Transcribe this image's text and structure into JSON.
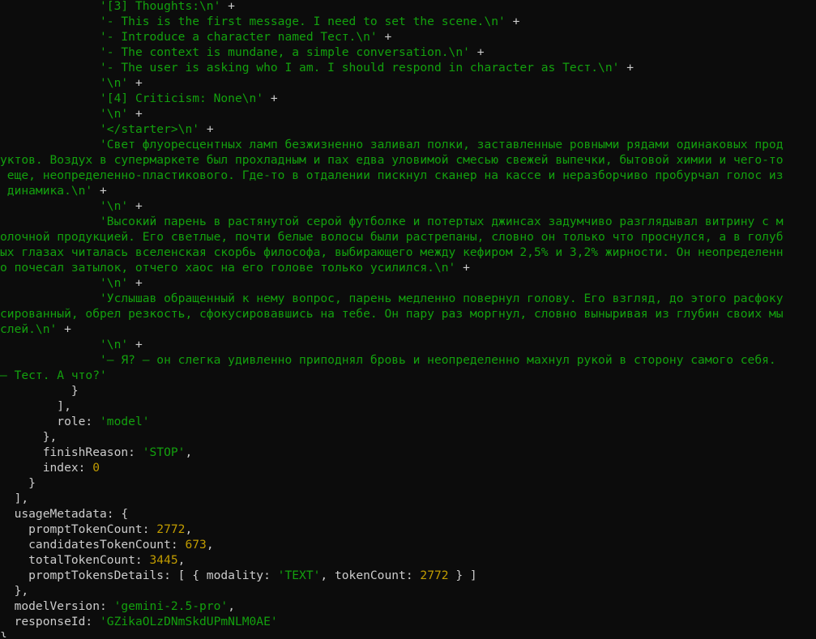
{
  "terminal": {
    "colors": {
      "background": "#0c0c0c",
      "default": "#cccccc",
      "string": "#13a10e",
      "number": "#c19c00"
    },
    "lines": [
      [
        {
          "t": "              ",
          "c": "p"
        },
        {
          "t": "'[3] Thoughts:\\n'",
          "c": "s"
        },
        {
          "t": " +",
          "c": "p"
        }
      ],
      [
        {
          "t": "              ",
          "c": "p"
        },
        {
          "t": "'- This is the first message. I need to set the scene.\\n'",
          "c": "s"
        },
        {
          "t": " +",
          "c": "p"
        }
      ],
      [
        {
          "t": "              ",
          "c": "p"
        },
        {
          "t": "'- Introduce a character named Тест.\\n'",
          "c": "s"
        },
        {
          "t": " +",
          "c": "p"
        }
      ],
      [
        {
          "t": "              ",
          "c": "p"
        },
        {
          "t": "'- The context is mundane, a simple conversation.\\n'",
          "c": "s"
        },
        {
          "t": " +",
          "c": "p"
        }
      ],
      [
        {
          "t": "              ",
          "c": "p"
        },
        {
          "t": "'- The user is asking who I am. I should respond in character as Тест.\\n'",
          "c": "s"
        },
        {
          "t": " +",
          "c": "p"
        }
      ],
      [
        {
          "t": "              ",
          "c": "p"
        },
        {
          "t": "'\\n'",
          "c": "s"
        },
        {
          "t": " +",
          "c": "p"
        }
      ],
      [
        {
          "t": "              ",
          "c": "p"
        },
        {
          "t": "'[4] Criticism: None\\n'",
          "c": "s"
        },
        {
          "t": " +",
          "c": "p"
        }
      ],
      [
        {
          "t": "              ",
          "c": "p"
        },
        {
          "t": "'\\n'",
          "c": "s"
        },
        {
          "t": " +",
          "c": "p"
        }
      ],
      [
        {
          "t": "              ",
          "c": "p"
        },
        {
          "t": "'</starter>\\n'",
          "c": "s"
        },
        {
          "t": " +",
          "c": "p"
        }
      ],
      [
        {
          "t": "              ",
          "c": "p"
        },
        {
          "t": "'Свет флуоресцентных ламп безжизненно заливал полки, заставленные ровными рядами одинаковых прод",
          "c": "s"
        }
      ],
      [
        {
          "t": "уктов. Воздух в супермаркете был прохладным и пах едва уловимой смесью свежей выпечки, бытовой химии и чего-то",
          "c": "s"
        }
      ],
      [
        {
          "t": " еще, неопределенно-пластикового. Где-то в отдалении пискнул сканер на кассе и неразборчиво пробурчал голос из",
          "c": "s"
        }
      ],
      [
        {
          "t": " динамика.\\n'",
          "c": "s"
        },
        {
          "t": " +",
          "c": "p"
        }
      ],
      [
        {
          "t": "              ",
          "c": "p"
        },
        {
          "t": "'\\n'",
          "c": "s"
        },
        {
          "t": " +",
          "c": "p"
        }
      ],
      [
        {
          "t": "              ",
          "c": "p"
        },
        {
          "t": "'Высокий парень в растянутой серой футболке и потертых джинсах задумчиво разглядывал витрину с м",
          "c": "s"
        }
      ],
      [
        {
          "t": "олочной продукцией. Его светлые, почти белые волосы были растрепаны, словно он только что проснулся, а в голуб",
          "c": "s"
        }
      ],
      [
        {
          "t": "ых глазах читалась вселенская скорбь философа, выбирающего между кефиром 2,5% и 3,2% жирности. Он неопределенн",
          "c": "s"
        }
      ],
      [
        {
          "t": "о почесал затылок, отчего хаос на его голове только усилился.\\n'",
          "c": "s"
        },
        {
          "t": " +",
          "c": "p"
        }
      ],
      [
        {
          "t": "              ",
          "c": "p"
        },
        {
          "t": "'\\n'",
          "c": "s"
        },
        {
          "t": " +",
          "c": "p"
        }
      ],
      [
        {
          "t": "              ",
          "c": "p"
        },
        {
          "t": "'Услышав обращенный к нему вопрос, парень медленно повернул голову. Его взгляд, до этого расфоку",
          "c": "s"
        }
      ],
      [
        {
          "t": "сированный, обрел резкость, сфокусировавшись на тебе. Он пару раз моргнул, словно выныривая из глубин своих мы",
          "c": "s"
        }
      ],
      [
        {
          "t": "слей.\\n'",
          "c": "s"
        },
        {
          "t": " +",
          "c": "p"
        }
      ],
      [
        {
          "t": "              ",
          "c": "p"
        },
        {
          "t": "'\\n'",
          "c": "s"
        },
        {
          "t": " +",
          "c": "p"
        }
      ],
      [
        {
          "t": "              ",
          "c": "p"
        },
        {
          "t": "'— Я? — он слегка удивленно приподнял бровь и неопределенно махнул рукой в сторону самого себя.",
          "c": "s"
        }
      ],
      [
        {
          "t": "— Тест. А что?'",
          "c": "s"
        }
      ],
      [
        {
          "t": "          }",
          "c": "p"
        }
      ],
      [
        {
          "t": "        ],",
          "c": "p"
        }
      ],
      [
        {
          "t": "        role: ",
          "c": "p"
        },
        {
          "t": "'model'",
          "c": "s"
        }
      ],
      [
        {
          "t": "      },",
          "c": "p"
        }
      ],
      [
        {
          "t": "      finishReason: ",
          "c": "p"
        },
        {
          "t": "'STOP'",
          "c": "s"
        },
        {
          "t": ",",
          "c": "p"
        }
      ],
      [
        {
          "t": "      index: ",
          "c": "p"
        },
        {
          "t": "0",
          "c": "n"
        }
      ],
      [
        {
          "t": "    }",
          "c": "p"
        }
      ],
      [
        {
          "t": "  ],",
          "c": "p"
        }
      ],
      [
        {
          "t": "  usageMetadata: {",
          "c": "p"
        }
      ],
      [
        {
          "t": "    promptTokenCount: ",
          "c": "p"
        },
        {
          "t": "2772",
          "c": "n"
        },
        {
          "t": ",",
          "c": "p"
        }
      ],
      [
        {
          "t": "    candidatesTokenCount: ",
          "c": "p"
        },
        {
          "t": "673",
          "c": "n"
        },
        {
          "t": ",",
          "c": "p"
        }
      ],
      [
        {
          "t": "    totalTokenCount: ",
          "c": "p"
        },
        {
          "t": "3445",
          "c": "n"
        },
        {
          "t": ",",
          "c": "p"
        }
      ],
      [
        {
          "t": "    promptTokensDetails: [ { modality: ",
          "c": "p"
        },
        {
          "t": "'TEXT'",
          "c": "s"
        },
        {
          "t": ", tokenCount: ",
          "c": "p"
        },
        {
          "t": "2772",
          "c": "n"
        },
        {
          "t": " } ]",
          "c": "p"
        }
      ],
      [
        {
          "t": "  },",
          "c": "p"
        }
      ],
      [
        {
          "t": "  modelVersion: ",
          "c": "p"
        },
        {
          "t": "'gemini-2.5-pro'",
          "c": "s"
        },
        {
          "t": ",",
          "c": "p"
        }
      ],
      [
        {
          "t": "  responseId: ",
          "c": "p"
        },
        {
          "t": "'GZikaOLzDNmSkdUPmNLM0AE'",
          "c": "s"
        }
      ],
      [
        {
          "t": "}",
          "c": "p"
        }
      ]
    ]
  }
}
